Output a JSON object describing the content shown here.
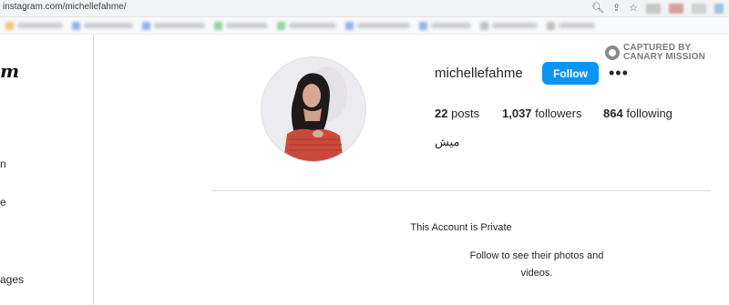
{
  "browser": {
    "url": "instagram.com/michellefahme/",
    "icons": [
      "zoom-icon",
      "share-icon",
      "star-icon",
      "extensions-icon",
      "profile-icon",
      "menu-icon"
    ]
  },
  "sidebar": {
    "logo_fragment": "m",
    "items": [
      {
        "label": "n"
      },
      {
        "label": "e"
      },
      {
        "label": "ages"
      }
    ]
  },
  "profile": {
    "username": "michellefahme",
    "follow_label": "Follow",
    "more_label": "•••",
    "posts_count": "22",
    "posts_label": "posts",
    "followers_count": "1,037",
    "followers_label": "followers",
    "following_count": "864",
    "following_label": "following",
    "bio": "ميش"
  },
  "watermark": {
    "line1": "CAPTURED BY",
    "line2": "CANARY MISSION"
  },
  "private": {
    "title": "This Account is Private",
    "subtitle": "Follow to see their photos and videos."
  },
  "colors": {
    "follow_button": "#0a95f6",
    "divider": "#dbdbdb",
    "text": "#262626"
  }
}
